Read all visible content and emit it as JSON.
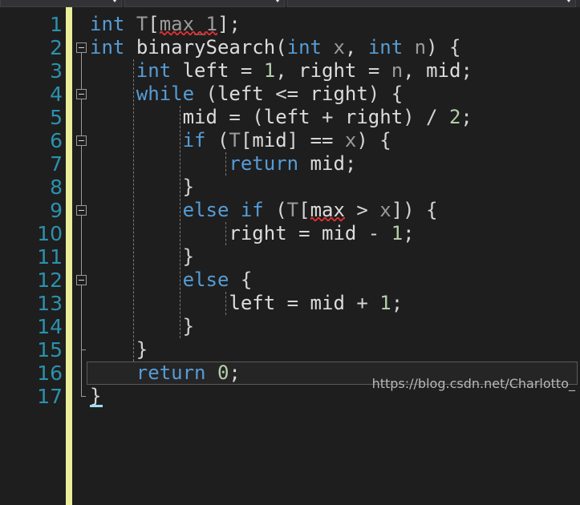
{
  "navbar": {
    "combos": [
      {
        "name": "project-dropdown",
        "value": ""
      },
      {
        "name": "type-dropdown",
        "value": ""
      },
      {
        "name": "member-dropdown",
        "value": ""
      }
    ]
  },
  "editor": {
    "language": "C++",
    "current_line": 16,
    "caret_line": 17,
    "colors": {
      "background": "#1e1e1e",
      "line_number": "#2b91af",
      "keyword": "#569cd6",
      "identifier": "#dcdcdc",
      "variable": "#9b9b9b",
      "number": "#b5cea8",
      "change_strip": "#eaee9a",
      "error_squiggle": "#e03030",
      "caret": "#9cdcfe",
      "current_line_border": "#5a5a5a"
    },
    "line_numbers": [
      "1",
      "2",
      "3",
      "4",
      "5",
      "6",
      "7",
      "8",
      "9",
      "10",
      "11",
      "12",
      "13",
      "14",
      "15",
      "16",
      "17"
    ],
    "lines": [
      {
        "n": 1,
        "indent": 0,
        "text": "int T[max_1];",
        "tokens": [
          {
            "t": "int",
            "c": "kw"
          },
          {
            "t": " ",
            "c": "punc"
          },
          {
            "t": "T",
            "c": "var"
          },
          {
            "t": "[",
            "c": "punc"
          },
          {
            "t": "max_1",
            "c": "var"
          },
          {
            "t": "]",
            "c": "punc"
          },
          {
            "t": ";",
            "c": "punc"
          }
        ]
      },
      {
        "n": 2,
        "indent": 0,
        "text": "int binarySearch(int x, int n) {",
        "tokens": [
          {
            "t": "int",
            "c": "kw"
          },
          {
            "t": " ",
            "c": "punc"
          },
          {
            "t": "binarySearch",
            "c": "plain"
          },
          {
            "t": "(",
            "c": "punc"
          },
          {
            "t": "int",
            "c": "kw"
          },
          {
            "t": " ",
            "c": "punc"
          },
          {
            "t": "x",
            "c": "var"
          },
          {
            "t": ", ",
            "c": "punc"
          },
          {
            "t": "int",
            "c": "kw"
          },
          {
            "t": " ",
            "c": "punc"
          },
          {
            "t": "n",
            "c": "var"
          },
          {
            "t": ") {",
            "c": "punc"
          }
        ]
      },
      {
        "n": 3,
        "indent": 1,
        "text": "int left = 1, right = n, mid;",
        "tokens": [
          {
            "t": "int",
            "c": "kw"
          },
          {
            "t": " ",
            "c": "punc"
          },
          {
            "t": "left",
            "c": "plain"
          },
          {
            "t": " = ",
            "c": "punc"
          },
          {
            "t": "1",
            "c": "num"
          },
          {
            "t": ", ",
            "c": "punc"
          },
          {
            "t": "right",
            "c": "plain"
          },
          {
            "t": " = ",
            "c": "punc"
          },
          {
            "t": "n",
            "c": "var"
          },
          {
            "t": ", ",
            "c": "punc"
          },
          {
            "t": "mid",
            "c": "plain"
          },
          {
            "t": ";",
            "c": "punc"
          }
        ]
      },
      {
        "n": 4,
        "indent": 1,
        "text": "while (left <= right) {",
        "tokens": [
          {
            "t": "while",
            "c": "kw"
          },
          {
            "t": " (",
            "c": "punc"
          },
          {
            "t": "left",
            "c": "plain"
          },
          {
            "t": " <= ",
            "c": "punc"
          },
          {
            "t": "right",
            "c": "plain"
          },
          {
            "t": ") {",
            "c": "punc"
          }
        ]
      },
      {
        "n": 5,
        "indent": 2,
        "text": "mid = (left + right) / 2;",
        "tokens": [
          {
            "t": "mid",
            "c": "plain"
          },
          {
            "t": " = (",
            "c": "punc"
          },
          {
            "t": "left",
            "c": "plain"
          },
          {
            "t": " + ",
            "c": "punc"
          },
          {
            "t": "right",
            "c": "plain"
          },
          {
            "t": ") / ",
            "c": "punc"
          },
          {
            "t": "2",
            "c": "num"
          },
          {
            "t": ";",
            "c": "punc"
          }
        ]
      },
      {
        "n": 6,
        "indent": 2,
        "text": "if (T[mid] == x) {",
        "tokens": [
          {
            "t": "if",
            "c": "kw"
          },
          {
            "t": " (",
            "c": "punc"
          },
          {
            "t": "T",
            "c": "var"
          },
          {
            "t": "[",
            "c": "punc"
          },
          {
            "t": "mid",
            "c": "plain"
          },
          {
            "t": "] == ",
            "c": "punc"
          },
          {
            "t": "x",
            "c": "var"
          },
          {
            "t": ") {",
            "c": "punc"
          }
        ]
      },
      {
        "n": 7,
        "indent": 3,
        "text": "return mid;",
        "tokens": [
          {
            "t": "return",
            "c": "kw"
          },
          {
            "t": " ",
            "c": "punc"
          },
          {
            "t": "mid",
            "c": "plain"
          },
          {
            "t": ";",
            "c": "punc"
          }
        ]
      },
      {
        "n": 8,
        "indent": 2,
        "text": "}",
        "tokens": [
          {
            "t": "}",
            "c": "punc"
          }
        ]
      },
      {
        "n": 9,
        "indent": 2,
        "text": "else if (T[max > x]) {",
        "tokens": [
          {
            "t": "else",
            "c": "kw"
          },
          {
            "t": " ",
            "c": "punc"
          },
          {
            "t": "if",
            "c": "kw"
          },
          {
            "t": " (",
            "c": "punc"
          },
          {
            "t": "T",
            "c": "var"
          },
          {
            "t": "[",
            "c": "punc"
          },
          {
            "t": "max",
            "c": "plain"
          },
          {
            "t": " > ",
            "c": "punc"
          },
          {
            "t": "x",
            "c": "var"
          },
          {
            "t": "]) {",
            "c": "punc"
          }
        ]
      },
      {
        "n": 10,
        "indent": 3,
        "text": "right = mid - 1;",
        "tokens": [
          {
            "t": "right",
            "c": "plain"
          },
          {
            "t": " = ",
            "c": "punc"
          },
          {
            "t": "mid",
            "c": "plain"
          },
          {
            "t": " - ",
            "c": "punc"
          },
          {
            "t": "1",
            "c": "num"
          },
          {
            "t": ";",
            "c": "punc"
          }
        ]
      },
      {
        "n": 11,
        "indent": 2,
        "text": "}",
        "tokens": [
          {
            "t": "}",
            "c": "punc"
          }
        ]
      },
      {
        "n": 12,
        "indent": 2,
        "text": "else {",
        "tokens": [
          {
            "t": "else",
            "c": "kw"
          },
          {
            "t": " {",
            "c": "punc"
          }
        ]
      },
      {
        "n": 13,
        "indent": 3,
        "text": "left = mid + 1;",
        "tokens": [
          {
            "t": "left",
            "c": "plain"
          },
          {
            "t": " = ",
            "c": "punc"
          },
          {
            "t": "mid",
            "c": "plain"
          },
          {
            "t": " + ",
            "c": "punc"
          },
          {
            "t": "1",
            "c": "num"
          },
          {
            "t": ";",
            "c": "punc"
          }
        ]
      },
      {
        "n": 14,
        "indent": 2,
        "text": "}",
        "tokens": [
          {
            "t": "}",
            "c": "punc"
          }
        ]
      },
      {
        "n": 15,
        "indent": 1,
        "text": "}",
        "tokens": [
          {
            "t": "}",
            "c": "punc"
          }
        ]
      },
      {
        "n": 16,
        "indent": 1,
        "text": "return 0;",
        "tokens": [
          {
            "t": "return",
            "c": "kw"
          },
          {
            "t": " ",
            "c": "punc"
          },
          {
            "t": "0",
            "c": "num"
          },
          {
            "t": ";",
            "c": "punc"
          }
        ]
      },
      {
        "n": 17,
        "indent": 0,
        "text": "}",
        "tokens": [
          {
            "t": "}",
            "c": "punc"
          }
        ]
      }
    ],
    "error_squiggles": [
      {
        "line": 1,
        "word": "max_1"
      },
      {
        "line": 9,
        "word": "max"
      }
    ],
    "fold_markers": [
      {
        "line": 2,
        "state": "expanded"
      },
      {
        "line": 4,
        "state": "expanded"
      },
      {
        "line": 6,
        "state": "expanded"
      },
      {
        "line": 9,
        "state": "expanded"
      },
      {
        "line": 12,
        "state": "expanded"
      }
    ]
  },
  "watermark": {
    "text": "https://blog.csdn.net/Charlotto_"
  }
}
